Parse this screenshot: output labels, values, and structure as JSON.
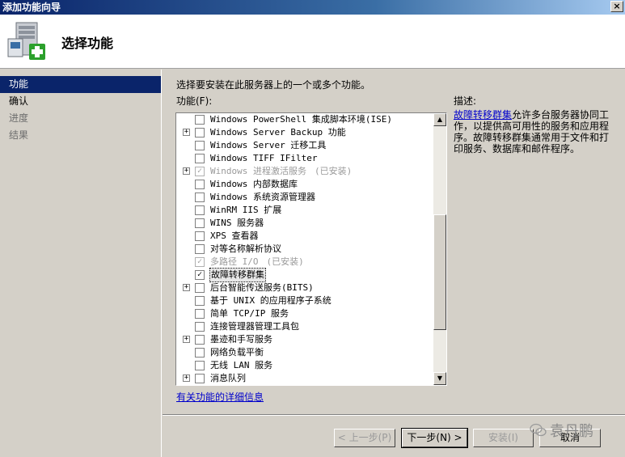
{
  "window": {
    "title": "添加功能向导",
    "close_label": "×"
  },
  "header": {
    "title": "选择功能"
  },
  "sidebar": {
    "items": [
      {
        "label": "功能",
        "state": "active"
      },
      {
        "label": "确认",
        "state": "done"
      },
      {
        "label": "进度",
        "state": "pending"
      },
      {
        "label": "结果",
        "state": "pending"
      }
    ]
  },
  "main": {
    "instruction": "选择要安装在此服务器上的一个或多个功能。",
    "list_label": "功能(F):",
    "features": [
      {
        "label": "Windows PowerShell 集成脚本环境(ISE)",
        "expandable": false,
        "checked": false,
        "disabled": false,
        "suffix": ""
      },
      {
        "label": "Windows Server Backup 功能",
        "expandable": true,
        "checked": false,
        "disabled": false,
        "suffix": ""
      },
      {
        "label": "Windows Server 迁移工具",
        "expandable": false,
        "checked": false,
        "disabled": false,
        "suffix": ""
      },
      {
        "label": "Windows TIFF IFilter",
        "expandable": false,
        "checked": false,
        "disabled": false,
        "suffix": ""
      },
      {
        "label": "Windows 进程激活服务",
        "expandable": true,
        "checked": true,
        "disabled": true,
        "suffix": "(已安装)"
      },
      {
        "label": "Windows 内部数据库",
        "expandable": false,
        "checked": false,
        "disabled": false,
        "suffix": ""
      },
      {
        "label": "Windows 系统资源管理器",
        "expandable": false,
        "checked": false,
        "disabled": false,
        "suffix": ""
      },
      {
        "label": "WinRM IIS 扩展",
        "expandable": false,
        "checked": false,
        "disabled": false,
        "suffix": ""
      },
      {
        "label": "WINS 服务器",
        "expandable": false,
        "checked": false,
        "disabled": false,
        "suffix": ""
      },
      {
        "label": "XPS 查看器",
        "expandable": false,
        "checked": false,
        "disabled": false,
        "suffix": ""
      },
      {
        "label": "对等名称解析协议",
        "expandable": false,
        "checked": false,
        "disabled": false,
        "suffix": ""
      },
      {
        "label": "多路径 I/O",
        "expandable": false,
        "checked": true,
        "disabled": true,
        "suffix": "(已安装)"
      },
      {
        "label": "故障转移群集",
        "expandable": false,
        "checked": true,
        "disabled": false,
        "selected": true,
        "suffix": ""
      },
      {
        "label": "后台智能传送服务(BITS)",
        "expandable": true,
        "checked": false,
        "disabled": false,
        "suffix": ""
      },
      {
        "label": "基于 UNIX 的应用程序子系统",
        "expandable": false,
        "checked": false,
        "disabled": false,
        "suffix": ""
      },
      {
        "label": "简单 TCP/IP 服务",
        "expandable": false,
        "checked": false,
        "disabled": false,
        "suffix": ""
      },
      {
        "label": "连接管理器管理工具包",
        "expandable": false,
        "checked": false,
        "disabled": false,
        "suffix": ""
      },
      {
        "label": "墨迹和手写服务",
        "expandable": true,
        "checked": false,
        "disabled": false,
        "suffix": ""
      },
      {
        "label": "网络负载平衡",
        "expandable": false,
        "checked": false,
        "disabled": false,
        "suffix": ""
      },
      {
        "label": "无线 LAN 服务",
        "expandable": false,
        "checked": false,
        "disabled": false,
        "suffix": ""
      },
      {
        "label": "消息队列",
        "expandable": true,
        "checked": false,
        "disabled": false,
        "suffix": ""
      }
    ],
    "more_info_link": "有关功能的详细信息"
  },
  "description": {
    "label": "描述:",
    "link_text": "故障转移群集",
    "text": "允许多台服务器协同工作，以提供高可用性的服务和应用程序。故障转移群集通常用于文件和打印服务、数据库和邮件程序。"
  },
  "buttons": {
    "back": "< 上一步(P)",
    "next": "下一步(N) >",
    "install": "安装(I)",
    "cancel": "取消"
  },
  "watermark": {
    "text": "袁丹鹏"
  },
  "icons": {
    "expand": "+",
    "check": "✓",
    "scroll_up": "▲",
    "scroll_down": "▼"
  }
}
